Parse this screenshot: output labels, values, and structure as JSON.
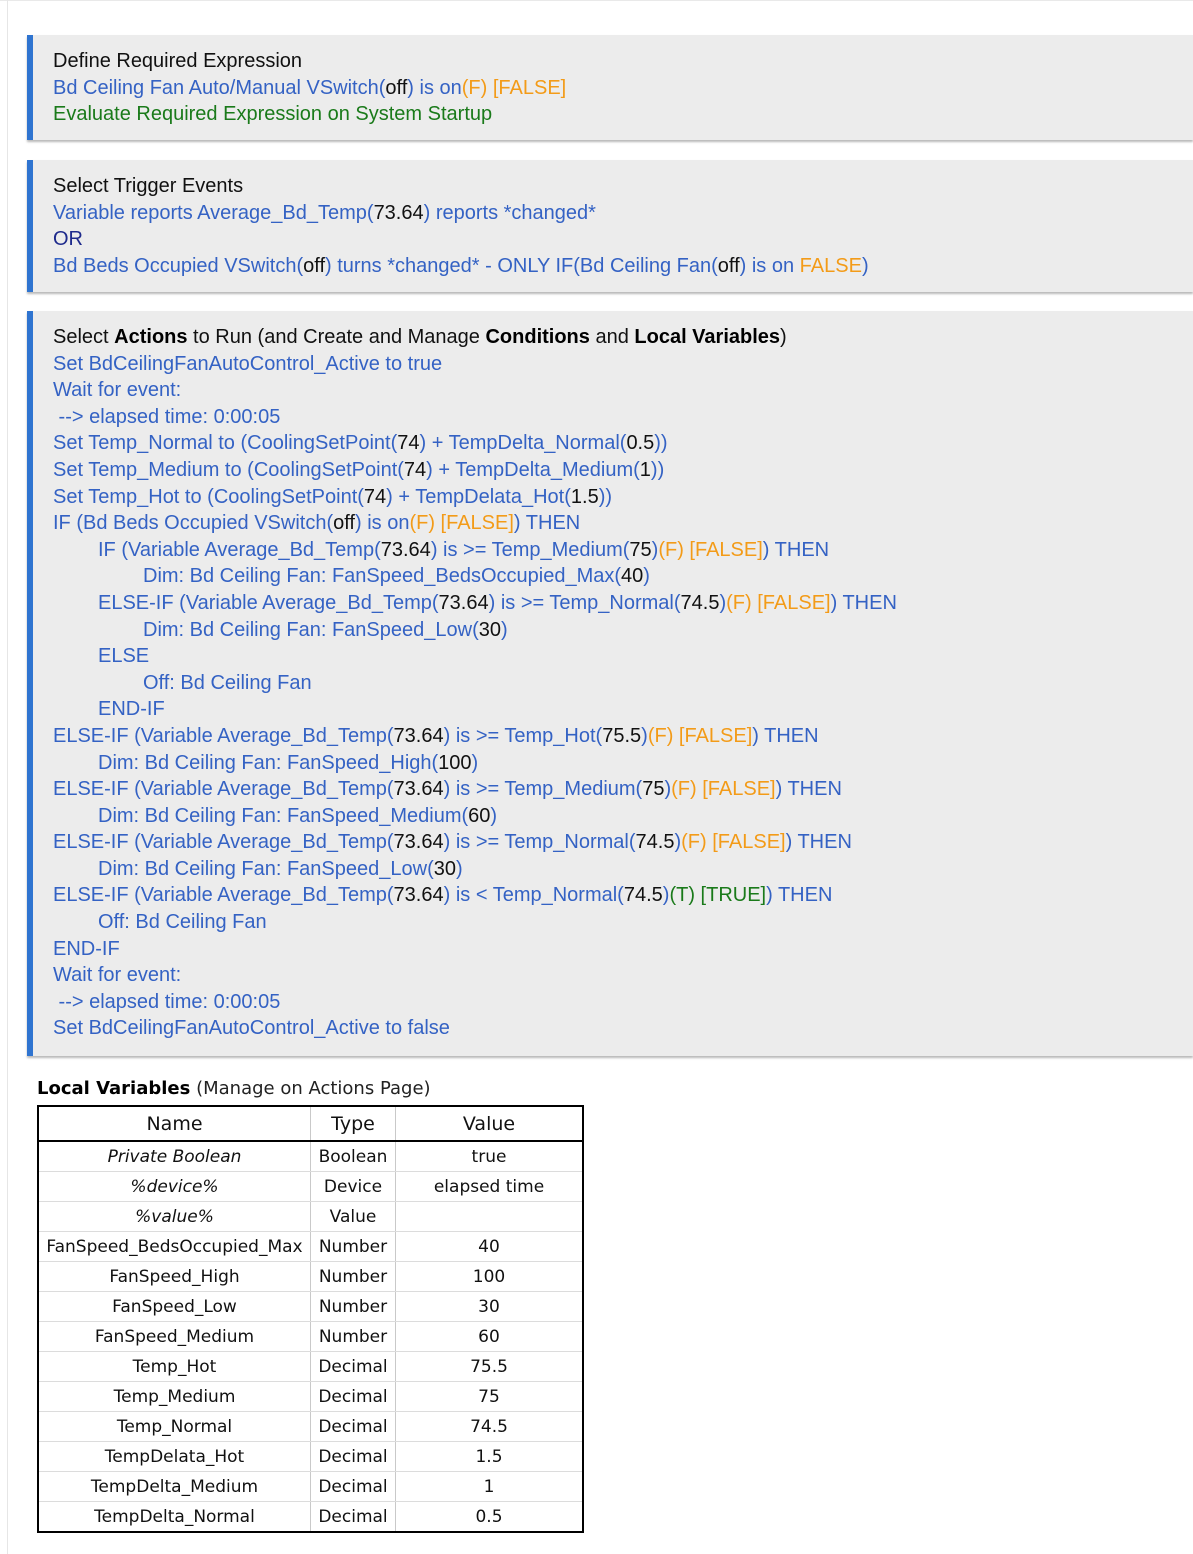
{
  "required_expression": {
    "title": "Define Required Expression",
    "line": [
      "Bd Ceiling Fan Auto/Manual VSwitch(",
      "off",
      ") is on",
      "(F) [FALSE]"
    ],
    "startup": "Evaluate Required Expression on System Startup"
  },
  "trigger_events": {
    "title": "Select Trigger Events",
    "event1": [
      "Variable reports Average_Bd_Temp(",
      "73.64",
      ") reports *changed*"
    ],
    "or": "OR",
    "event2": [
      "Bd Beds Occupied VSwitch(",
      "off",
      ") turns *changed* - ONLY IF(Bd Ceiling Fan(",
      "off",
      ") is on ",
      "FALSE",
      ")"
    ]
  },
  "actions": {
    "title": [
      "Select ",
      "Actions",
      " to Run (and Create and Manage ",
      "Conditions",
      " and ",
      "Local Variables",
      ")"
    ],
    "l1": "Set BdCeilingFanAutoControl_Active to true",
    "l2": "Wait for event:",
    "l3": " --> elapsed time: 0:00:05",
    "l4": [
      "Set Temp_Normal to (CoolingSetPoint(",
      "74",
      ") + TempDelta_Normal(",
      "0.5",
      "))"
    ],
    "l5": [
      "Set Temp_Medium to (CoolingSetPoint(",
      "74",
      ") + TempDelta_Medium(",
      "1",
      "))"
    ],
    "l6": [
      "Set Temp_Hot to (CoolingSetPoint(",
      "74",
      ") + TempDelata_Hot(",
      "1.5",
      "))"
    ],
    "l7": [
      "IF (Bd Beds Occupied VSwitch(",
      "off",
      ") is on",
      "(F) [FALSE]",
      ") THEN"
    ],
    "l8": [
      "IF (Variable Average_Bd_Temp(",
      "73.64",
      ") is >= Temp_Medium(",
      "75",
      ")",
      "(F) [FALSE]",
      ") THEN"
    ],
    "l9": [
      "Dim: Bd Ceiling Fan: FanSpeed_BedsOccupied_Max(",
      "40",
      ")"
    ],
    "l10": [
      "ELSE-IF (Variable Average_Bd_Temp(",
      "73.64",
      ") is >= Temp_Normal(",
      "74.5",
      ")",
      "(F) [FALSE]",
      ") THEN"
    ],
    "l11": [
      "Dim: Bd Ceiling Fan: FanSpeed_Low(",
      "30",
      ")"
    ],
    "l12": "ELSE",
    "l13": "Off: Bd Ceiling Fan",
    "l14": "END-IF",
    "l15": [
      "ELSE-IF (Variable Average_Bd_Temp(",
      "73.64",
      ") is >= Temp_Hot(",
      "75.5",
      ")",
      "(F) [FALSE]",
      ") THEN"
    ],
    "l16": [
      "Dim: Bd Ceiling Fan: FanSpeed_High(",
      "100",
      ")"
    ],
    "l17": [
      "ELSE-IF (Variable Average_Bd_Temp(",
      "73.64",
      ") is >= Temp_Medium(",
      "75",
      ")",
      "(F) [FALSE]",
      ") THEN"
    ],
    "l18": [
      "Dim: Bd Ceiling Fan: FanSpeed_Medium(",
      "60",
      ")"
    ],
    "l19": [
      "ELSE-IF (Variable Average_Bd_Temp(",
      "73.64",
      ") is >= Temp_Normal(",
      "74.5",
      ")",
      "(F) [FALSE]",
      ") THEN"
    ],
    "l20": [
      "Dim: Bd Ceiling Fan: FanSpeed_Low(",
      "30",
      ")"
    ],
    "l21": [
      "ELSE-IF (Variable Average_Bd_Temp(",
      "73.64",
      ") is < Temp_Normal(",
      "74.5",
      ")",
      "(T) [TRUE]",
      ") THEN"
    ],
    "l22": "Off: Bd Ceiling Fan",
    "l23": "END-IF",
    "l24": "Wait for event:",
    "l25": " --> elapsed time: 0:00:05",
    "l26": "Set BdCeilingFanAutoControl_Active to false"
  },
  "local_variables": {
    "title_bold": "Local Variables",
    "title_rest": " (Manage on Actions Page)",
    "columns": [
      "Name",
      "Type",
      "Value"
    ],
    "rows": [
      [
        "Private Boolean",
        "Boolean",
        "true"
      ],
      [
        "%device%",
        "Device",
        "elapsed time"
      ],
      [
        "%value%",
        "Value",
        ""
      ],
      [
        "FanSpeed_BedsOccupied_Max",
        "Number",
        "40"
      ],
      [
        "FanSpeed_High",
        "Number",
        "100"
      ],
      [
        "FanSpeed_Low",
        "Number",
        "30"
      ],
      [
        "FanSpeed_Medium",
        "Number",
        "60"
      ],
      [
        "Temp_Hot",
        "Decimal",
        "75.5"
      ],
      [
        "Temp_Medium",
        "Decimal",
        "75"
      ],
      [
        "Temp_Normal",
        "Decimal",
        "74.5"
      ],
      [
        "TempDelata_Hot",
        "Decimal",
        "1.5"
      ],
      [
        "TempDelta_Medium",
        "Decimal",
        "1"
      ],
      [
        "TempDelta_Normal",
        "Decimal",
        "0.5"
      ]
    ]
  },
  "colors": {
    "accent_bar": "#2f74d0",
    "blue_text": "#3462c4",
    "orange_text": "#f39b18",
    "green_text": "#1a7a1a",
    "panel_bg": "#ececec"
  }
}
